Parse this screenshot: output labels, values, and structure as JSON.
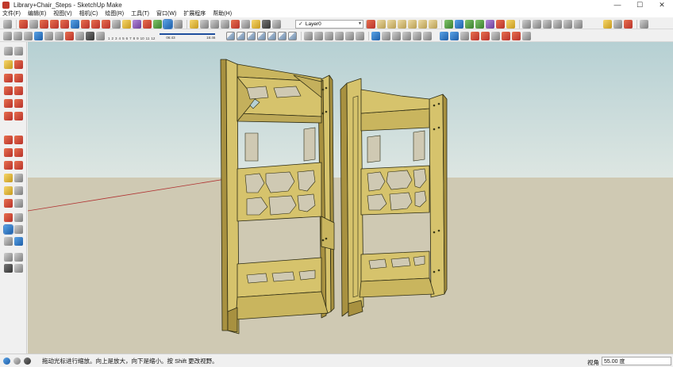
{
  "window": {
    "title": "Library+Chair_Steps - SketchUp Make",
    "minimize_glyph": "—",
    "maximize_glyph": "☐",
    "close_glyph": "✕"
  },
  "menu": [
    {
      "label": "文件(F)"
    },
    {
      "label": "编辑(E)"
    },
    {
      "label": "视图(V)"
    },
    {
      "label": "相机(C)"
    },
    {
      "label": "绘图(R)"
    },
    {
      "label": "工具(T)"
    },
    {
      "label": "窗口(W)"
    },
    {
      "label": "扩展程序"
    },
    {
      "label": "帮助(H)"
    }
  ],
  "layers": {
    "current": "Layer0",
    "check_glyph": "✓",
    "arrow_glyph": "▾"
  },
  "shadows": {
    "months": [
      "1",
      "2",
      "3",
      "4",
      "5",
      "6",
      "7",
      "8",
      "9",
      "10",
      "11",
      "12"
    ],
    "time_start": "06:43",
    "time_end": "16:46"
  },
  "status": {
    "hint": "拖动光标进行缩放。向上是放大，向下是缩小。按 Shift 更改视野。",
    "vcb_label": "视角",
    "vcb_value": "55.00 度"
  },
  "colors": {
    "sky": "#c9dcdc",
    "ground": "#cfc9b3",
    "wood": "#d6c36c",
    "wood_dark": "#a89140",
    "edge": "#2b2a12",
    "accent": "#1f4f9e"
  }
}
